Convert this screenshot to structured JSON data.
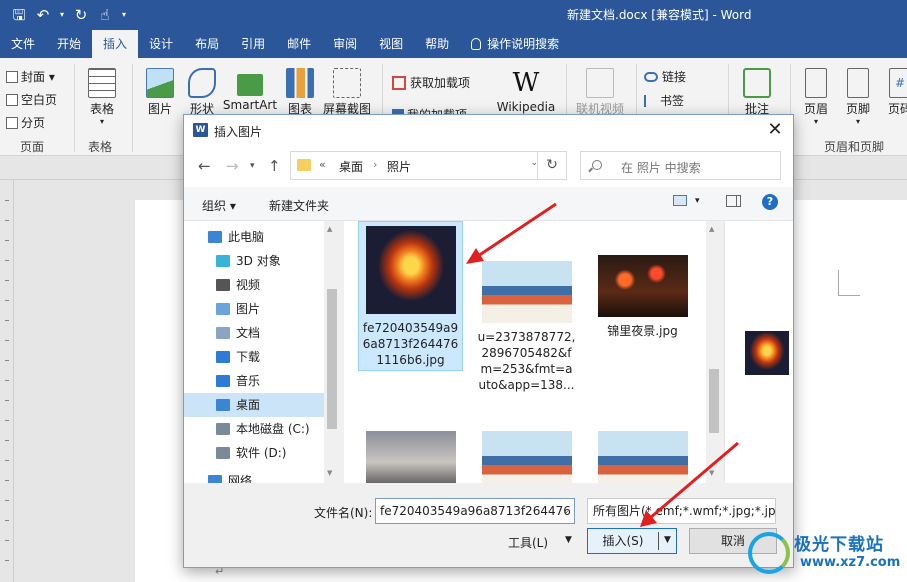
{
  "colors": {
    "word_blue": "#2b579a",
    "selection": "#cce8ff",
    "accent": "#1e6ec8",
    "arrow_red": "#e02020"
  },
  "titlebar": {
    "document_title": "新建文档.docx [兼容模式] - Word",
    "qat_icons": [
      "save-icon",
      "undo-icon",
      "redo-icon",
      "touch-mode-icon",
      "customize-qat-icon"
    ]
  },
  "tabs": [
    "文件",
    "开始",
    "插入",
    "设计",
    "布局",
    "引用",
    "邮件",
    "审阅",
    "视图",
    "帮助",
    "操作说明搜索"
  ],
  "active_tab": "插入",
  "ribbon": {
    "pages": {
      "cover": "封面",
      "blank": "空白页",
      "break": "分页",
      "group": "页面"
    },
    "tables": {
      "table": "表格",
      "group": "表格"
    },
    "illus": {
      "picture": "图片",
      "shapes": "形状",
      "smartart": "SmartArt",
      "chart": "图表",
      "screenshot": "屏幕截图"
    },
    "addins": {
      "get": "获取加载项",
      "mine": "我的加载项",
      "wiki": "Wikipedia"
    },
    "media": {
      "online_video": "联机视频"
    },
    "links": {
      "link": "链接",
      "bookmark": "书签"
    },
    "comments": {
      "comment": "批注"
    },
    "header_footer": {
      "header": "页眉",
      "footer": "页脚",
      "page_no": "页码",
      "group": "页眉和页脚"
    }
  },
  "dialog": {
    "title": "插入图片",
    "breadcrumb": {
      "prefix": "«",
      "folder1": "桌面",
      "folder2": "照片"
    },
    "search_placeholder": "在 照片 中搜索",
    "toolbar": {
      "organize": "组织 ▾",
      "new_folder": "新建文件夹"
    },
    "nav_items": [
      {
        "label": "此电脑",
        "icon": "computer-icon",
        "color": "#3a86d4"
      },
      {
        "label": "3D 对象",
        "icon": "3d-objects-icon",
        "color": "#37b4d6"
      },
      {
        "label": "视频",
        "icon": "video-icon",
        "color": "#555555"
      },
      {
        "label": "图片",
        "icon": "pictures-icon",
        "color": "#6aa5d9"
      },
      {
        "label": "文档",
        "icon": "documents-icon",
        "color": "#8aa4c4"
      },
      {
        "label": "下载",
        "icon": "downloads-icon",
        "color": "#2d7bd4"
      },
      {
        "label": "音乐",
        "icon": "music-icon",
        "color": "#2d7bd4"
      },
      {
        "label": "桌面",
        "icon": "desktop-icon",
        "color": "#3a86d4"
      },
      {
        "label": "本地磁盘 (C:)",
        "icon": "disk-c-icon",
        "color": "#7a8a99"
      },
      {
        "label": "软件 (D:)",
        "icon": "disk-d-icon",
        "color": "#7a8a99"
      },
      {
        "label": "网络",
        "icon": "network-icon",
        "color": "#3a86d4"
      }
    ],
    "selected_nav": "桌面",
    "files": [
      {
        "name": "fe720403549a96a8713f2644761116b6.jpg",
        "thumb": "fire"
      },
      {
        "name": "u=2373878772,2896705482&fm=253&fmt=auto&app=138...",
        "thumb": "anime"
      },
      {
        "name": "锦里夜景.jpg",
        "thumb": "night"
      },
      {
        "name": "",
        "thumb": "sky"
      },
      {
        "name": "",
        "thumb": "anime"
      },
      {
        "name": "",
        "thumb": "anime"
      }
    ],
    "selected_file_index": 0,
    "filename_label": "文件名(N):",
    "filename_value": "fe720403549a96a8713f264476",
    "filetype_value": "所有图片(*.emf;*.wmf;*.jpg;*.jp",
    "tools_label": "工具(L)",
    "insert_label": "插入(S)",
    "cancel_label": "取消"
  },
  "watermark": {
    "line1": "极光下载站",
    "line2": "www.xz7.com"
  }
}
